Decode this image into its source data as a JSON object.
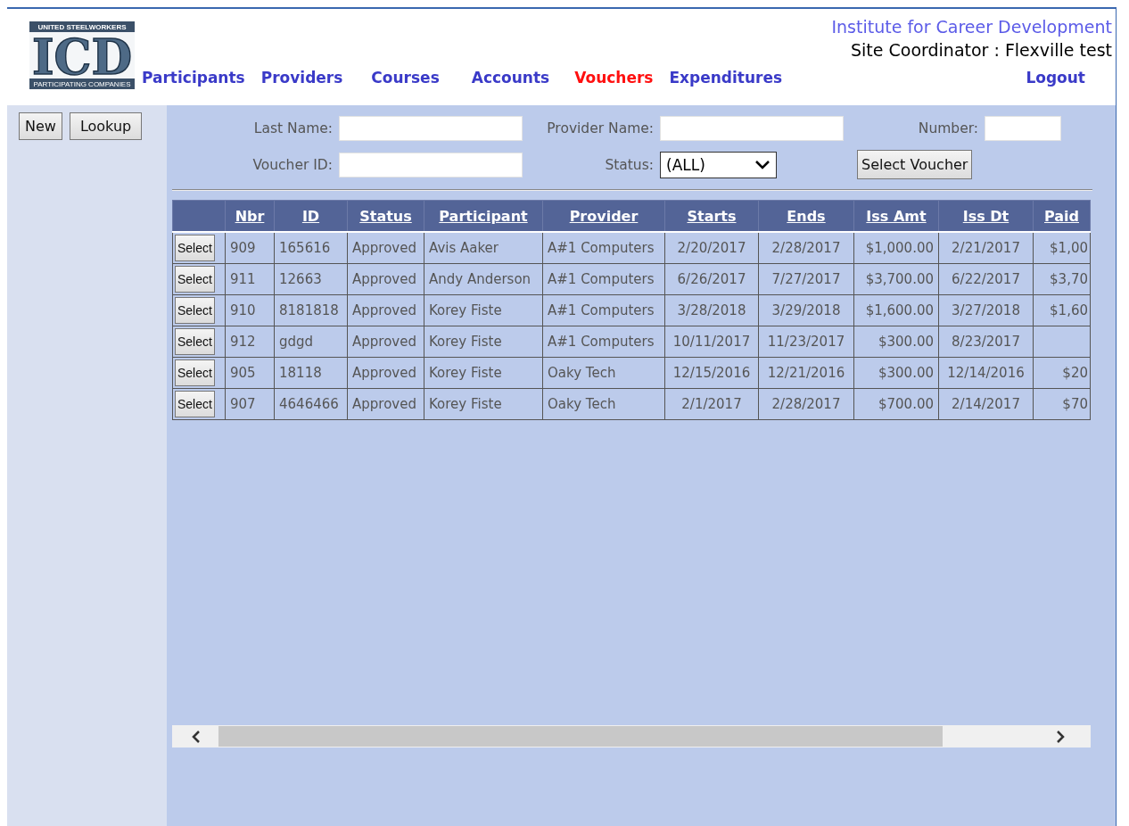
{
  "logo": {
    "top_text": "UNITED STEELWORKERS",
    "main_text": "ICD",
    "bottom_text": "PARTICIPATING COMPANIES"
  },
  "header": {
    "title": "Institute for Career Development",
    "user": "Site Coordinator : Flexville test"
  },
  "nav": [
    {
      "label": "Participants",
      "selected": false
    },
    {
      "label": "Providers",
      "selected": false
    },
    {
      "label": "Courses",
      "selected": false
    },
    {
      "label": "Accounts",
      "selected": false
    },
    {
      "label": "Vouchers",
      "selected": true
    },
    {
      "label": "Expenditures",
      "selected": false
    }
  ],
  "logout": "Logout",
  "sidebar": {
    "buttons": [
      "New",
      "Lookup"
    ]
  },
  "filters": {
    "last_name_label": "Last Name:",
    "provider_name_label": "Provider Name:",
    "number_label": "Number:",
    "voucher_id_label": "Voucher ID:",
    "status_label": "Status:",
    "status_value": "(ALL)",
    "submit": "Select Voucher"
  },
  "table": {
    "columns": [
      "Nbr",
      "ID",
      "Status",
      "Participant",
      "Provider",
      "Starts",
      "Ends",
      "Iss Amt",
      "Iss Dt",
      "Paid"
    ],
    "rows": [
      {
        "select": "Select",
        "nbr": "909",
        "id": "165616",
        "status": "Approved",
        "participant": "Avis Aaker",
        "provider": "A#1 Computers",
        "starts": "2/20/2017",
        "ends": "2/28/2017",
        "iss_amt": "$1,000.00",
        "iss_dt": "2/21/2017",
        "paid": "$1,00"
      },
      {
        "select": "Select",
        "nbr": "911",
        "id": "12663",
        "status": "Approved",
        "participant": "Andy Anderson",
        "provider": "A#1 Computers",
        "starts": "6/26/2017",
        "ends": "7/27/2017",
        "iss_amt": "$3,700.00",
        "iss_dt": "6/22/2017",
        "paid": "$3,70"
      },
      {
        "select": "Select",
        "nbr": "910",
        "id": "8181818",
        "status": "Approved",
        "participant": "Korey Fiste",
        "provider": "A#1 Computers",
        "starts": "3/28/2018",
        "ends": "3/29/2018",
        "iss_amt": "$1,600.00",
        "iss_dt": "3/27/2018",
        "paid": "$1,60"
      },
      {
        "select": "Select",
        "nbr": "912",
        "id": "gdgd",
        "status": "Approved",
        "participant": "Korey Fiste",
        "provider": "A#1 Computers",
        "starts": "10/11/2017",
        "ends": "11/23/2017",
        "iss_amt": "$300.00",
        "iss_dt": "8/23/2017"
      },
      {
        "select": "Select",
        "nbr": "905",
        "id": "18118",
        "status": "Approved",
        "participant": "Korey Fiste",
        "provider": "Oaky Tech",
        "starts": "12/15/2016",
        "ends": "12/21/2016",
        "iss_amt": "$300.00",
        "iss_dt": "12/14/2016",
        "paid": "$20"
      },
      {
        "select": "Select",
        "nbr": "907",
        "id": "4646466",
        "status": "Approved",
        "participant": "Korey Fiste",
        "provider": "Oaky Tech",
        "starts": "2/1/2017",
        "ends": "2/28/2017",
        "iss_amt": "$700.00",
        "iss_dt": "2/14/2017",
        "paid": "$70"
      }
    ]
  }
}
